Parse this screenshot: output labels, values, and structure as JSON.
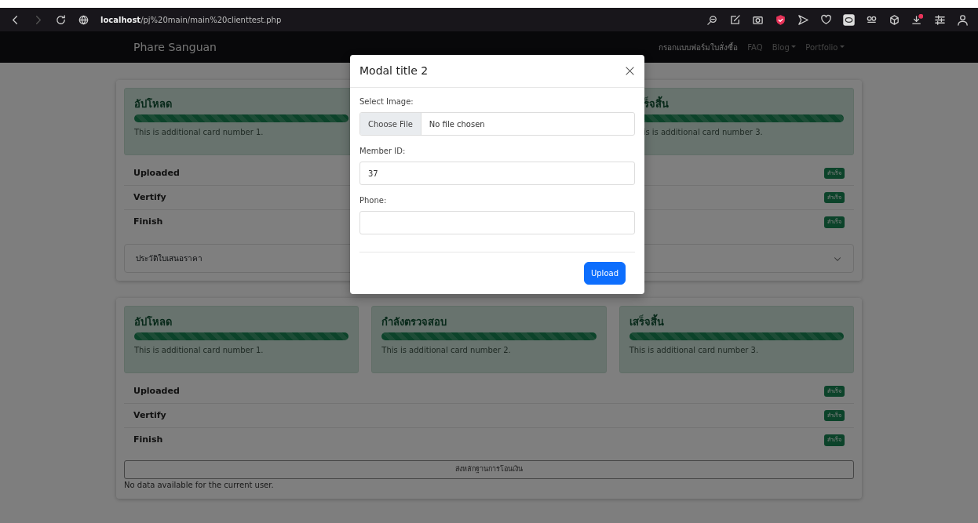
{
  "browser": {
    "url_host": "localhost",
    "url_path": "/pj%20main/main%20clienttest.php",
    "forward_disabled": true
  },
  "navbar": {
    "brand": "Phare Sanguan",
    "links": [
      {
        "label": "กรอกแบบฟอร์มใบสั่งซื้อ",
        "active": true,
        "dropdown": false
      },
      {
        "label": "FAQ",
        "active": false,
        "dropdown": false
      },
      {
        "label": "Blog",
        "active": false,
        "dropdown": true
      },
      {
        "label": "Portfolio",
        "active": false,
        "dropdown": true
      }
    ]
  },
  "sections": [
    {
      "steps": [
        {
          "kind": "card",
          "title": "อัปโหลด",
          "level": 1,
          "text": "This is additional card number 1."
        },
        {
          "kind": "blank"
        },
        {
          "kind": "cut",
          "title": "ร็จสิ้น",
          "level": 1,
          "text": "is is additional card number 3."
        }
      ],
      "rows": [
        {
          "label": "Uploaded",
          "badge": "สำเร็จ"
        },
        {
          "label": "Vertify",
          "badge": "สำเร็จ"
        },
        {
          "label": "Finish",
          "badge": "สำเร็จ"
        }
      ],
      "footer": {
        "kind": "accordion",
        "label": "ประวัติใบเสนอราคา",
        "expanded": false
      }
    },
    {
      "steps": [
        {
          "kind": "card",
          "title": "อัปโหลด",
          "level": 1,
          "text": "This is additional card number 1."
        },
        {
          "kind": "card",
          "title": "กำลังตรวจสอบ",
          "level": 1,
          "text": "This is additional card number 2."
        },
        {
          "kind": "card",
          "title": "เสร็จสิ้น",
          "level": 1,
          "text": "This is additional card number 3."
        }
      ],
      "rows": [
        {
          "label": "Uploaded",
          "badge": "สำเร็จ"
        },
        {
          "label": "Vertify",
          "badge": "สำเร็จ"
        },
        {
          "label": "Finish",
          "badge": "สำเร็จ"
        }
      ],
      "footer": {
        "kind": "button",
        "label": "ส่งหลักฐานการโอนเงิน",
        "note": "No data available for the current user."
      }
    }
  ],
  "modal": {
    "title": "Modal title 2",
    "fields": [
      {
        "kind": "file",
        "label": "Select Image:",
        "button": "Choose File",
        "value": "No file chosen"
      },
      {
        "kind": "text",
        "label": "Member ID:",
        "value": "37"
      },
      {
        "kind": "text",
        "label": "Phone:"
      }
    ],
    "submit": "Upload"
  }
}
